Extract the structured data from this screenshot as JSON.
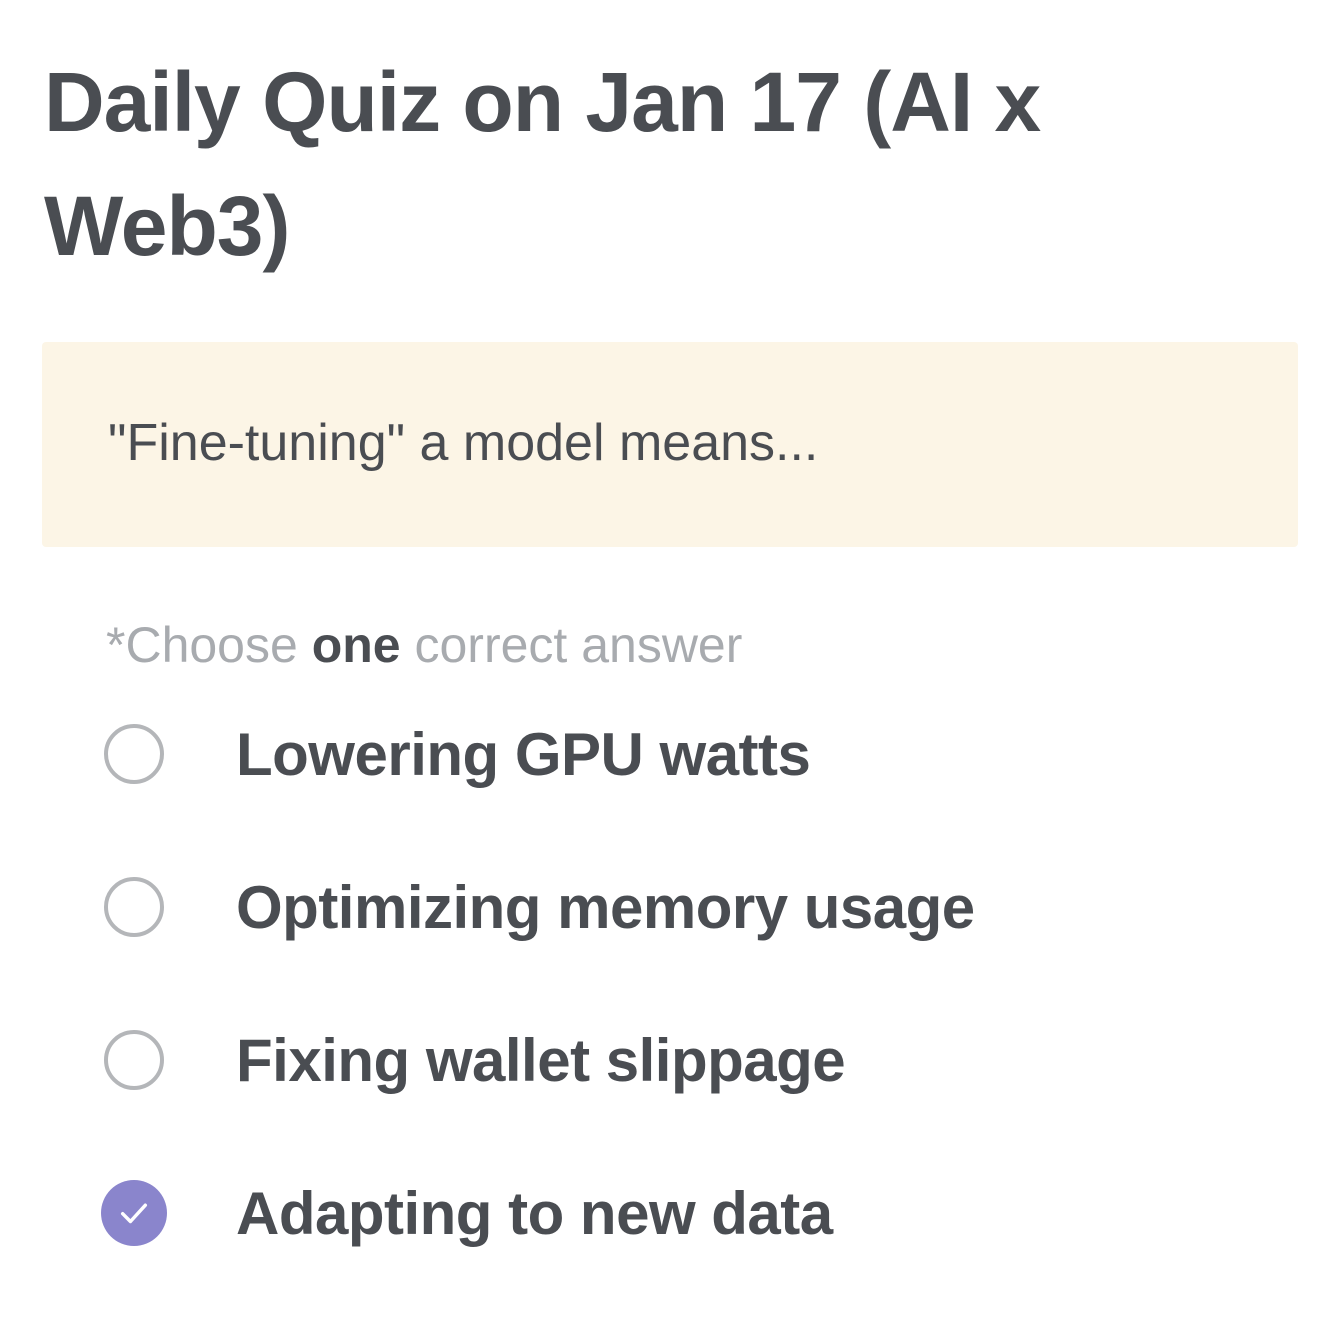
{
  "quiz": {
    "title": "Daily Quiz on Jan 17 (AI x Web3)",
    "question": "\"Fine-tuning\" a model means...",
    "instruction": {
      "prefix": "*Choose ",
      "emphasis": "one",
      "suffix": " correct answer"
    },
    "options": [
      {
        "label": "Lowering GPU watts",
        "selected": false
      },
      {
        "label": "Optimizing memory usage",
        "selected": false
      },
      {
        "label": "Fixing wallet slippage",
        "selected": false
      },
      {
        "label": "Adapting to new data",
        "selected": true
      }
    ]
  },
  "colors": {
    "text": "#4a4d52",
    "muted": "#a8abaf",
    "question_bg": "#fcf5e6",
    "radio_border": "#b4b6b9",
    "accent": "#8a85cc"
  },
  "icons": {
    "unselected": "radio-unchecked-icon",
    "selected": "check-icon"
  }
}
